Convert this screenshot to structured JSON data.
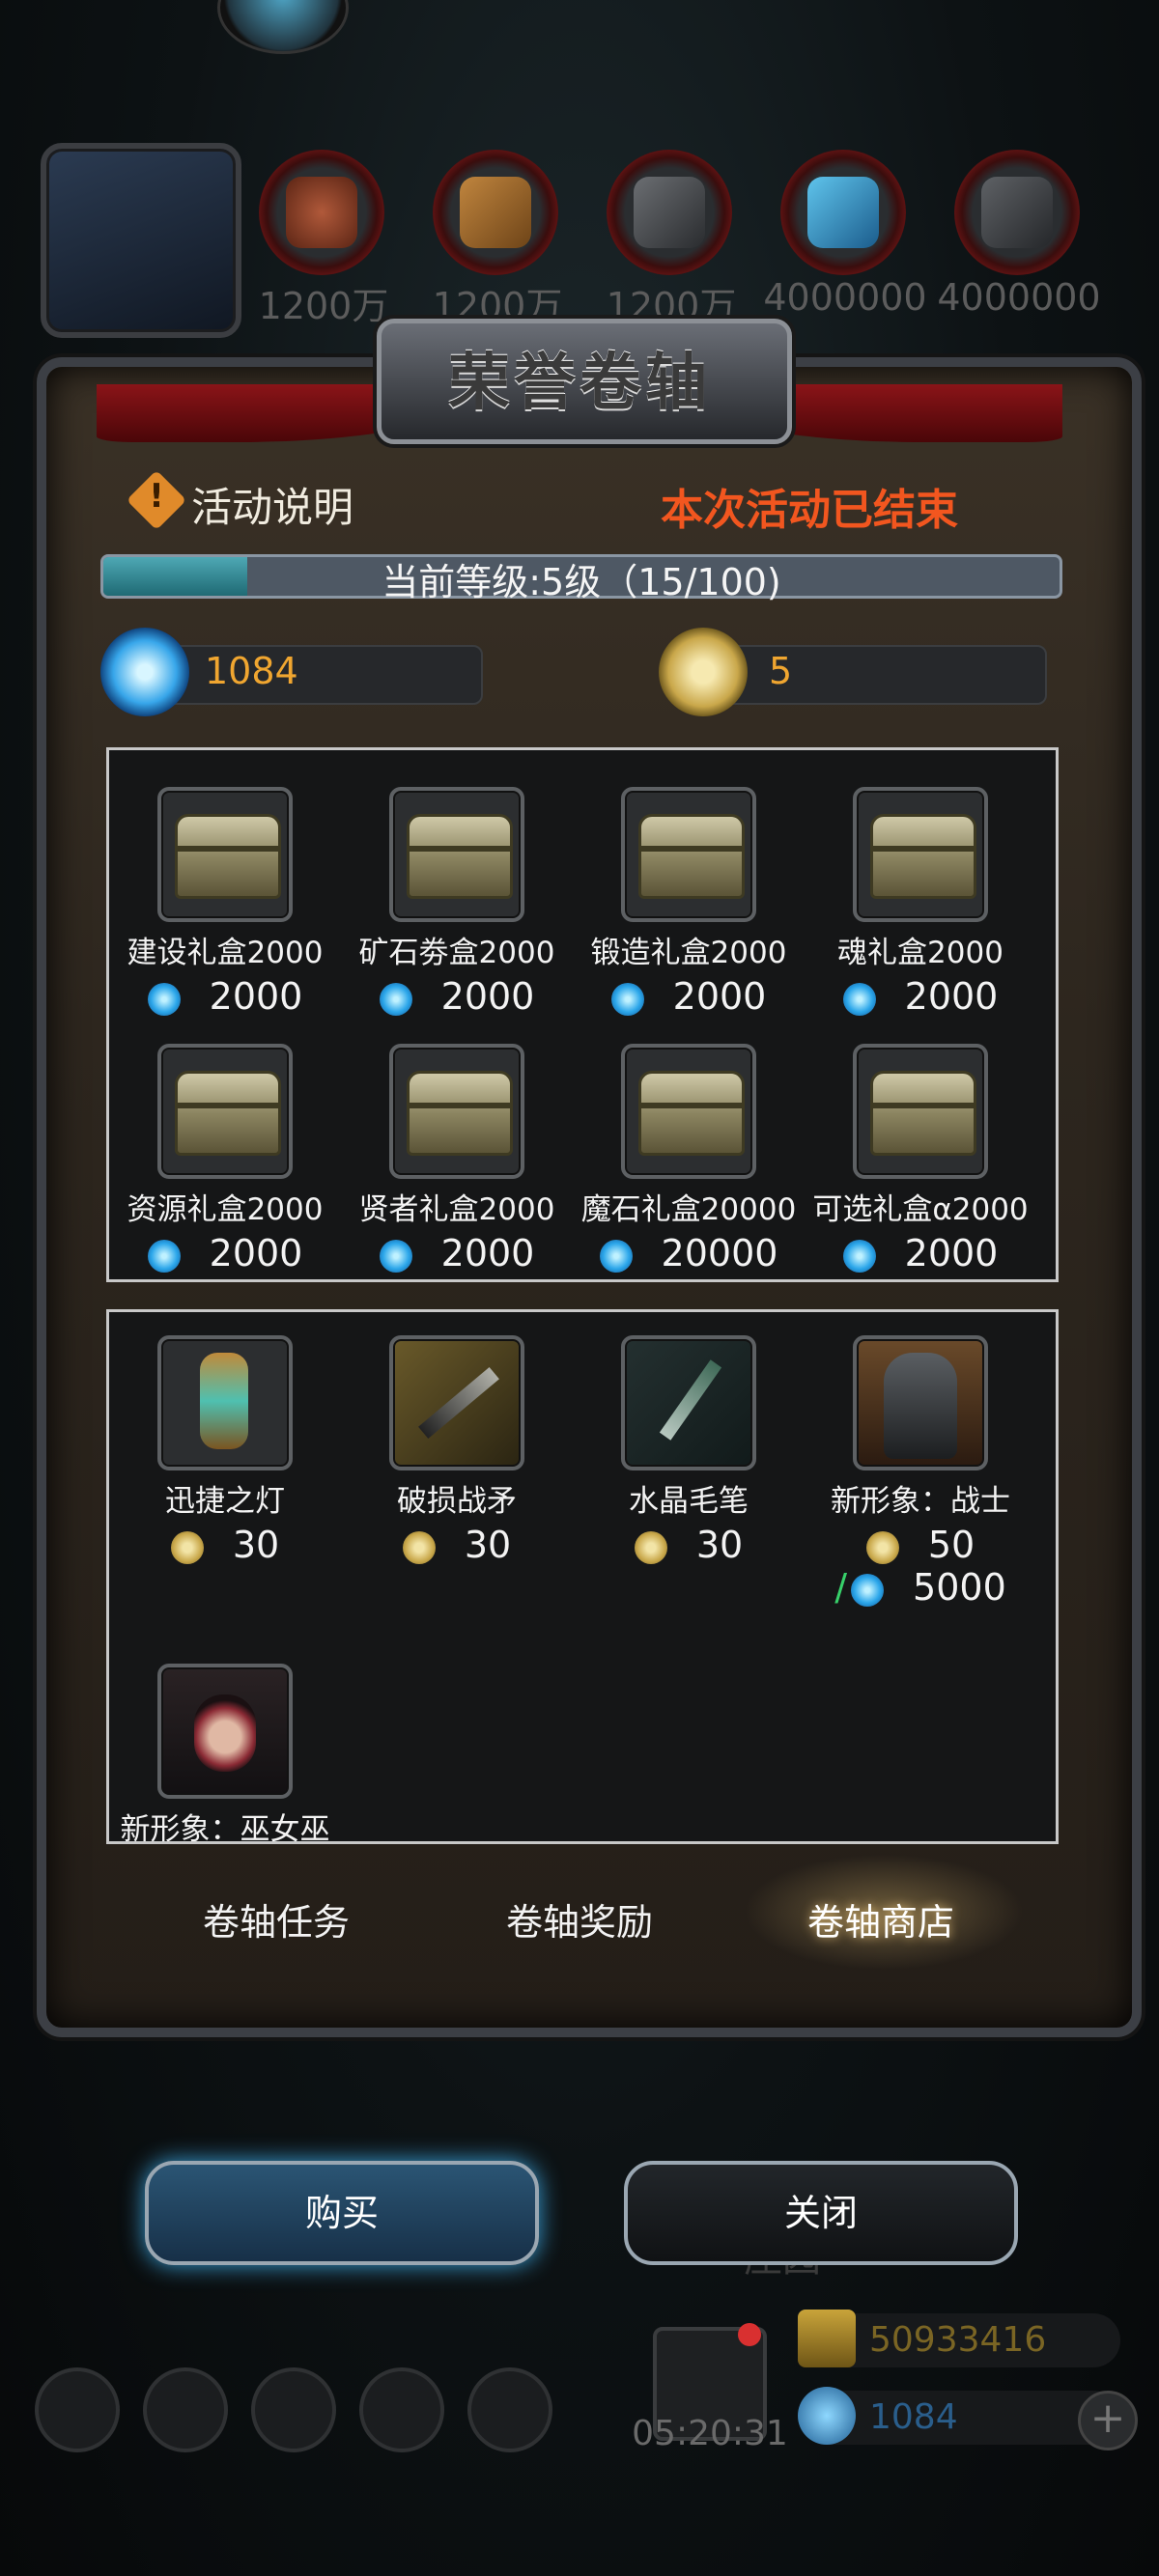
{
  "resources": [
    {
      "icon": "meat-icon",
      "amount": "1200万"
    },
    {
      "icon": "wood-icon",
      "amount": "1200万"
    },
    {
      "icon": "iron-icon",
      "amount": "1200万"
    },
    {
      "icon": "crystal-icon",
      "amount": "4000000"
    },
    {
      "icon": "stone-icon",
      "amount": "4000000"
    }
  ],
  "dialog": {
    "title": "荣誉卷轴",
    "info_label": "活动说明",
    "status": "本次活动已结束",
    "level_text": "当前等级:5级（15/100)",
    "level_progress": 0.15,
    "gem_currency": "1084",
    "coin_currency": "5"
  },
  "gem_shop": [
    {
      "name": "建设礼盒2000",
      "price": "2000"
    },
    {
      "name": "矿石劵盒2000",
      "price": "2000"
    },
    {
      "name": "锻造礼盒2000",
      "price": "2000"
    },
    {
      "name": "魂礼盒2000",
      "price": "2000"
    },
    {
      "name": "资源礼盒2000",
      "price": "2000"
    },
    {
      "name": "贤者礼盒2000",
      "price": "2000"
    },
    {
      "name": "魔石礼盒20000",
      "price": "20000"
    },
    {
      "name": "可选礼盒α2000",
      "price": "2000"
    }
  ],
  "coin_shop": [
    {
      "name": "迅捷之灯",
      "price": "30"
    },
    {
      "name": "破损战矛",
      "price": "30"
    },
    {
      "name": "水晶毛笔",
      "price": "30"
    },
    {
      "name": "新形象：战士",
      "price": "50",
      "alt_price": "5000",
      "alt_sep": "/"
    },
    {
      "name": "新形象：巫女巫",
      "price": ""
    }
  ],
  "tabs": [
    "卷轴任务",
    "卷轴奖励",
    "卷轴商店"
  ],
  "buttons": {
    "buy": "购买",
    "close": "关闭"
  },
  "hud": {
    "gold": "50933416",
    "gems": "1084",
    "timer": "05:20:31",
    "faded_label": "庄园"
  },
  "colors": {
    "accent_orange": "#f2561f",
    "gem_blue": "#2ba6ea",
    "currency_gold": "#f0a630"
  }
}
